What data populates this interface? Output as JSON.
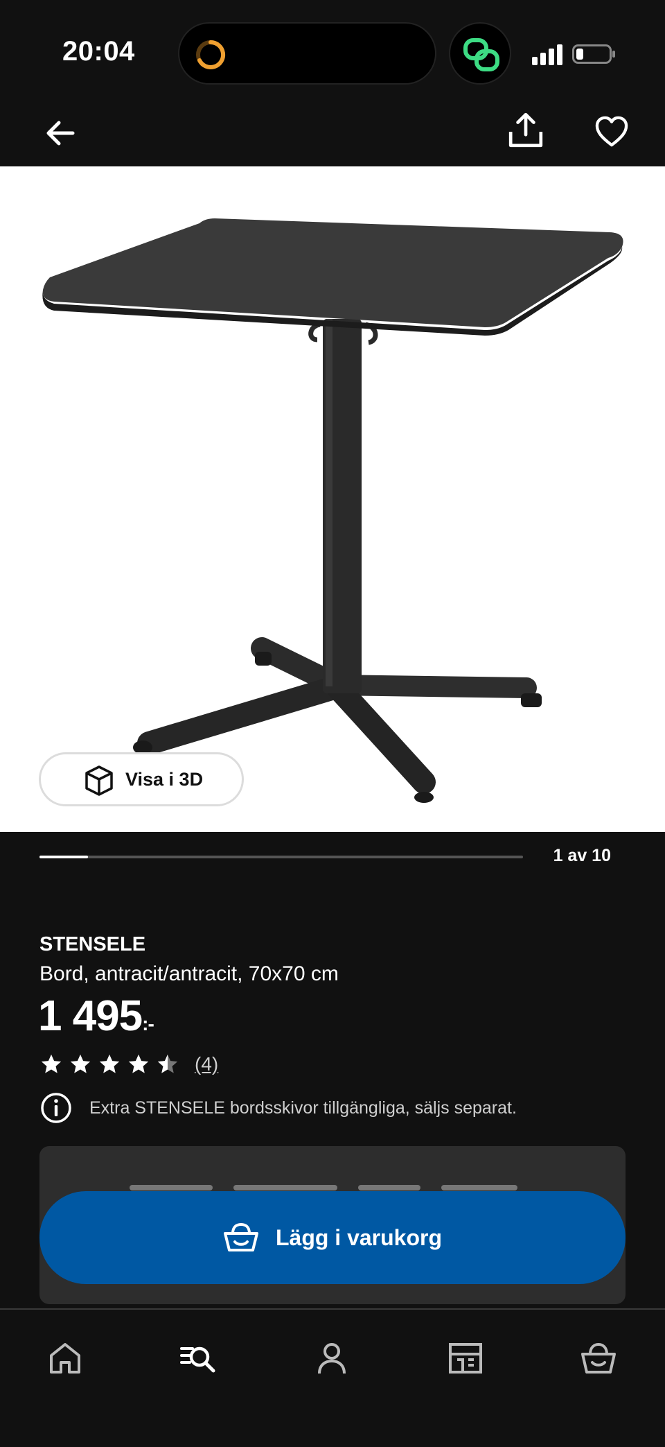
{
  "status_bar": {
    "time": "20:04"
  },
  "topnav": {
    "back_icon": "arrow-left-icon",
    "share_icon": "share-icon",
    "favorite_icon": "heart-icon"
  },
  "gallery": {
    "view_3d_label": "Visa i 3D",
    "counter": "1 av 10",
    "current_image": 1,
    "total_images": 10
  },
  "product": {
    "name": "STENSELE",
    "description": "Bord, antracit/antracit, 70x70 cm",
    "price": "1 495",
    "price_suffix": ":-",
    "rating": 4.5,
    "review_count": "(4)",
    "info_text": "Extra STENSELE bordsskivor tillgängliga, säljs separat."
  },
  "cart": {
    "add_label": "Lägg i varukorg"
  },
  "bottom_nav": {
    "items": [
      {
        "name": "home",
        "icon": "home-icon"
      },
      {
        "name": "search",
        "icon": "search-icon"
      },
      {
        "name": "profile",
        "icon": "person-icon"
      },
      {
        "name": "store",
        "icon": "store-icon"
      },
      {
        "name": "cart",
        "icon": "basket-icon"
      }
    ]
  },
  "colors": {
    "background": "#111111",
    "accent_blue": "#0058a3",
    "card": "#2d2d2d"
  }
}
